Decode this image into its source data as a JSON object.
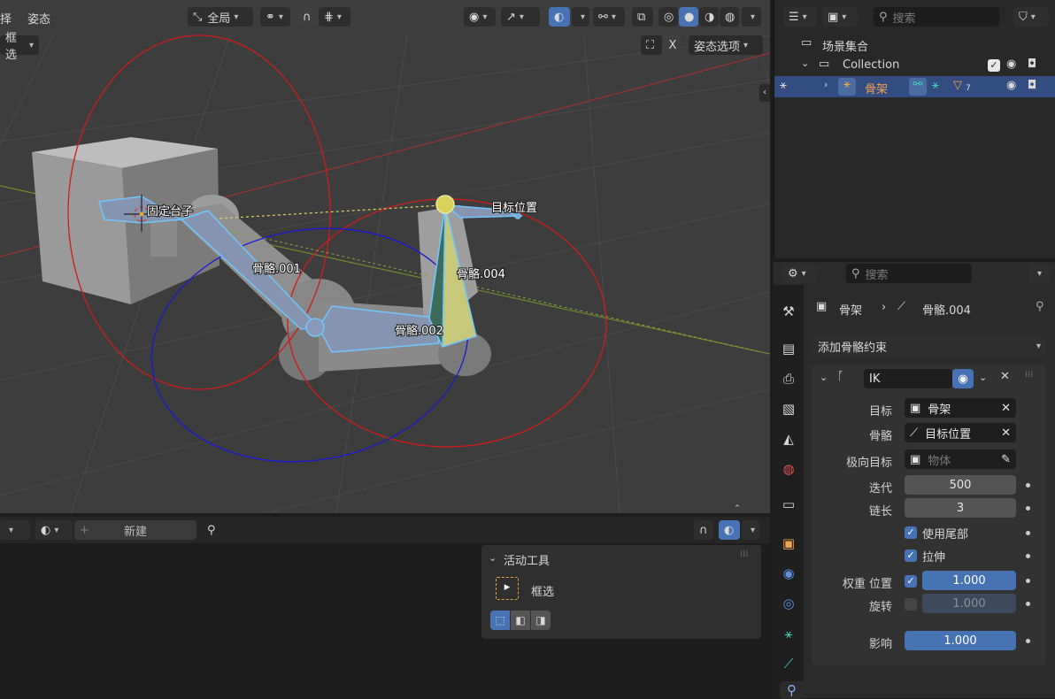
{
  "viewport": {
    "menu": {
      "select_partial": "择",
      "pose": "姿态"
    },
    "transform_orientation": "全局",
    "select_mode_partial": "框选",
    "mirror_x": "X",
    "pose_options": "姿态选项",
    "labels": {
      "fixed_base": "固定台子",
      "target_pos": "目标位置",
      "bone_001": "骨骼.001",
      "bone_002": "骨骼.002",
      "bone_004": "骨骼.004"
    },
    "colors": {
      "bg": "#3d3d3d",
      "bone_fill": "#8595b0",
      "bone_outline": "#6ec6ff",
      "ring_red": "#d11a1a",
      "ring_blue": "#1a1ad6",
      "active_bone": "#c8c87a"
    }
  },
  "outliner": {
    "search_placeholder": "搜索",
    "scene_collection": "场景集合",
    "collection": "Collection",
    "armature": "骨架",
    "armature_badge": "7"
  },
  "properties": {
    "search_placeholder": "搜索",
    "breadcrumb": {
      "object": "骨架",
      "bone": "骨骼.004"
    },
    "add_constraint": "添加骨骼约束",
    "constraint": {
      "name": "IK",
      "target_label": "目标",
      "target_value": "骨架",
      "bone_label": "骨骼",
      "bone_value": "目标位置",
      "pole_label": "极向目标",
      "pole_placeholder": "物体",
      "iterations_label": "迭代",
      "iterations": "500",
      "chain_label": "链长",
      "chain": "3",
      "use_tail": "使用尾部",
      "stretch": "拉伸",
      "weight_label": "权重 位置",
      "weight_position": "1.000",
      "rotation_label": "旋转",
      "weight_rotation": "1.000",
      "influence_label": "影响",
      "influence": "1.000"
    }
  },
  "bottom": {
    "new_button": "新建",
    "active_tool_title": "活动工具",
    "active_tool_name": "框选"
  }
}
